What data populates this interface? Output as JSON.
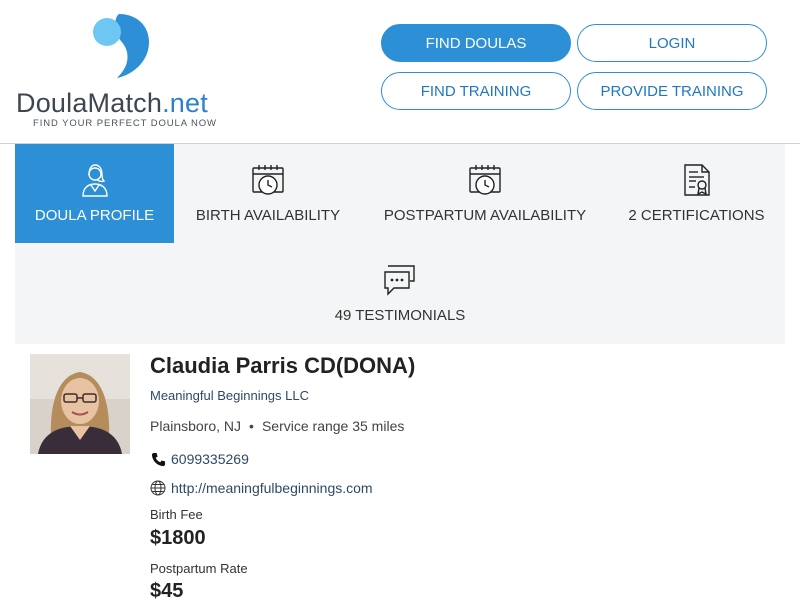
{
  "brand": {
    "name_main": "Doula",
    "name_accent": "Match",
    "name_tld": ".net",
    "tagline": "FIND YOUR PERFECT DOULA NOW",
    "colors": {
      "primary": "#2d8fd6",
      "text_dark": "#3d4750",
      "logo_light": "#6ec6f2"
    }
  },
  "nav": {
    "find_doulas": "FIND DOULAS",
    "login": "LOGIN",
    "find_training": "FIND TRAINING",
    "provide_training": "PROVIDE TRAINING"
  },
  "tabs": {
    "profile": {
      "label": "DOULA PROFILE",
      "icon": "doula-person-icon",
      "active": true
    },
    "birth": {
      "label": "BIRTH AVAILABILITY",
      "icon": "calendar-clock-icon"
    },
    "postpartum": {
      "label": "POSTPARTUM AVAILABILITY",
      "icon": "calendar-clock-icon"
    },
    "certifications": {
      "label": "2 CERTIFICATIONS",
      "icon": "certificate-icon"
    },
    "testimonials": {
      "label": "49 TESTIMONIALS",
      "icon": "chat-bubbles-icon"
    }
  },
  "profile": {
    "name": "Claudia Parris CD(DONA)",
    "company": "Meaningful Beginnings LLC",
    "city": "Plainsboro, NJ",
    "service_range": "Service range 35 miles",
    "phone": "6099335269",
    "website": "http://meaningfulbeginnings.com",
    "birth_fee_label": "Birth Fee",
    "birth_fee": "$1800",
    "postpartum_rate_label": "Postpartum Rate",
    "postpartum_rate": "$45"
  }
}
